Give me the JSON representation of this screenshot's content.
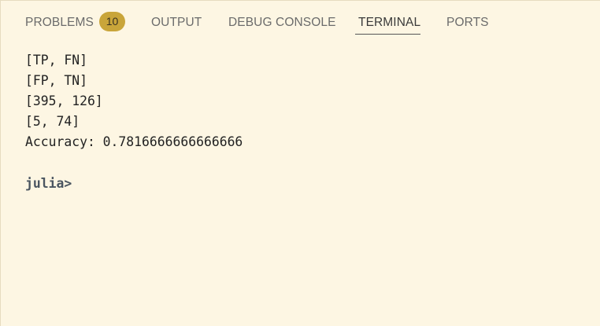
{
  "tabs": {
    "problems": {
      "label": "PROBLEMS",
      "badge": "10"
    },
    "output": {
      "label": "OUTPUT"
    },
    "debug_console": {
      "label": "DEBUG CONSOLE"
    },
    "terminal": {
      "label": "TERMINAL",
      "active": true
    },
    "ports": {
      "label": "PORTS"
    }
  },
  "terminal": {
    "lines": [
      "[TP, FN]",
      "[FP, TN]",
      "[395, 126]",
      "[5, 74]",
      "Accuracy: 0.7816666666666666"
    ],
    "prompt": "julia>"
  },
  "colors": {
    "background": "#fdf6e3",
    "badge": "#c9a53a",
    "active_underline": "#555555"
  }
}
